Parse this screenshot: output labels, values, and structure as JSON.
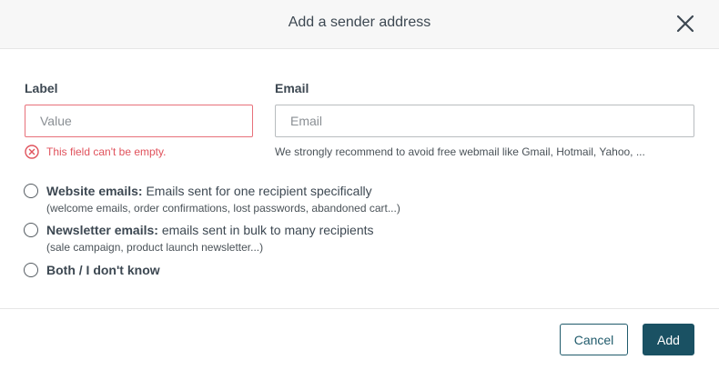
{
  "dialog": {
    "title": "Add a sender address"
  },
  "label_field": {
    "label": "Label",
    "value": "",
    "placeholder": "Value",
    "error": "This field can't be empty."
  },
  "email_field": {
    "label": "Email",
    "value": "",
    "placeholder": "Email",
    "hint": "We strongly recommend to avoid free webmail like Gmail, Hotmail, Yahoo, ..."
  },
  "options": [
    {
      "title": "Website emails:",
      "description": " Emails sent for one recipient specifically",
      "sub": "(welcome emails, order confirmations, lost passwords, abandoned cart...)",
      "selected": false
    },
    {
      "title": "Newsletter emails:",
      "description": " emails sent in bulk to many recipients",
      "sub": "(sale campaign, product launch newsletter...)",
      "selected": false
    },
    {
      "title": "Both / I don't know",
      "description": "",
      "sub": "",
      "selected": false
    }
  ],
  "buttons": {
    "cancel": "Cancel",
    "add": "Add"
  },
  "colors": {
    "error": "#e0525c",
    "primary": "#1a5163"
  },
  "icons": {
    "close": "close-icon",
    "error": "error-circle-icon"
  }
}
